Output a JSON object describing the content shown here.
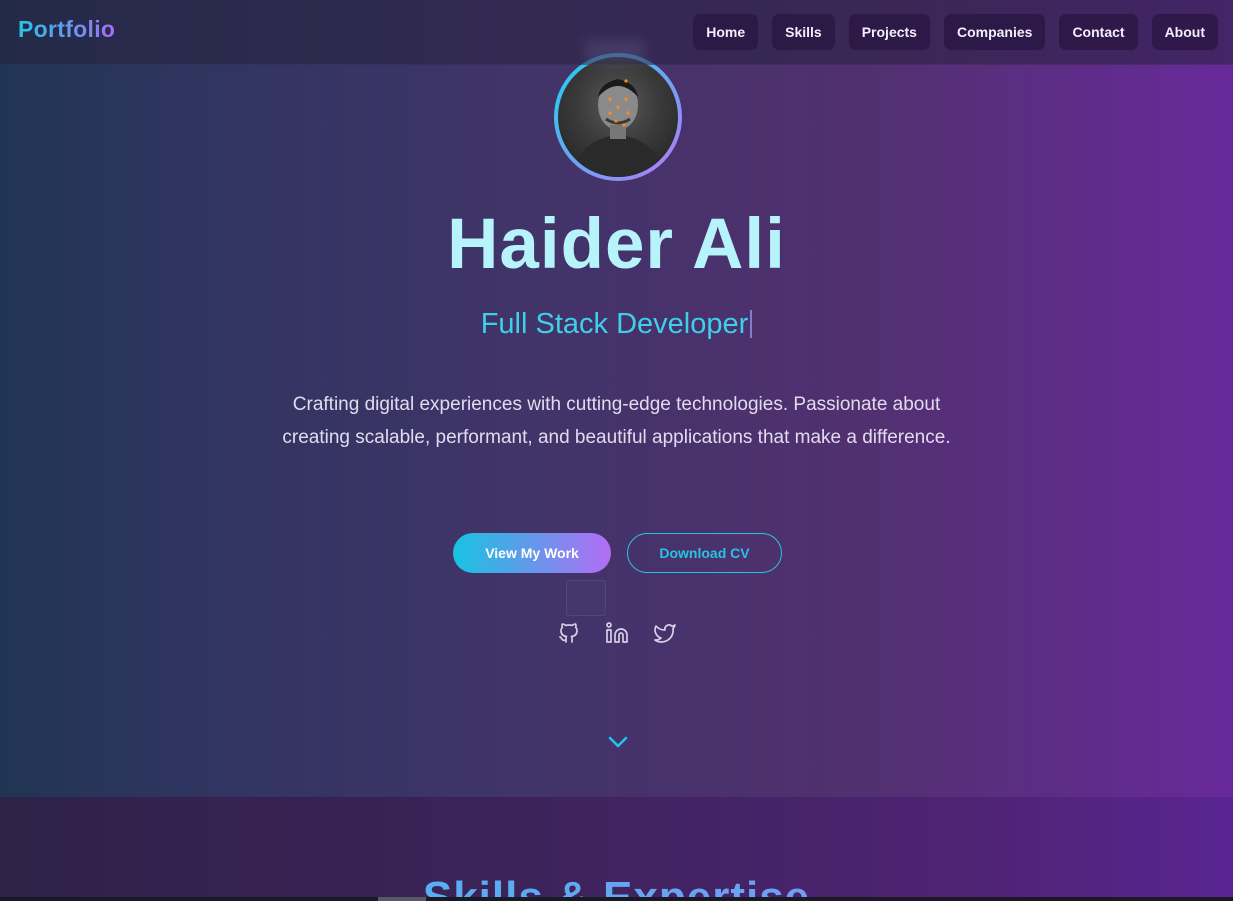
{
  "brand": "Portfolio",
  "nav": {
    "items": [
      "Home",
      "Skills",
      "Projects",
      "Companies",
      "Contact",
      "About"
    ]
  },
  "hero": {
    "name": "Haider Ali",
    "role": "Full Stack Developer",
    "bio": "Crafting digital experiences with cutting-edge technologies. Passionate about creating scalable, performant, and beautiful applications that make a difference.",
    "primary_button": "View My Work",
    "secondary_button": "Download CV",
    "social_icons": [
      "github-icon",
      "linkedin-icon",
      "twitter-icon"
    ],
    "scroll_icon": "chevron-down-icon"
  },
  "skills": {
    "title": "Skills & Expertise"
  },
  "colors": {
    "accent_cyan": "#22c7e6",
    "accent_purple": "#a86cf4",
    "name_color": "#b7f3fb"
  }
}
